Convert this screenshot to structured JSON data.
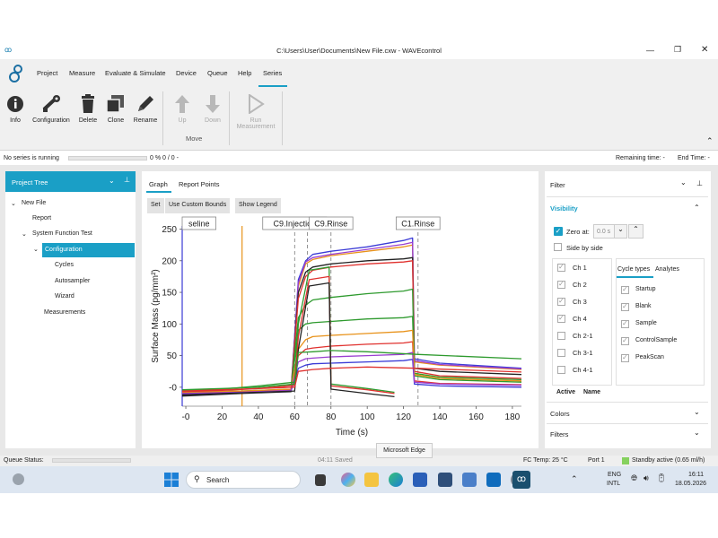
{
  "window": {
    "title": "C:\\Users\\User\\Documents\\New File.cxw - WAVEcontrol"
  },
  "menu": [
    "Project",
    "Measure",
    "Evaluate & Simulate",
    "Device",
    "Queue",
    "Help",
    "Series"
  ],
  "ribbon": {
    "info": "Info",
    "configuration": "Configuration",
    "delete": "Delete",
    "clone": "Clone",
    "rename": "Rename",
    "up": "Up",
    "down": "Down",
    "move_group": "Move",
    "run_line1": "Run",
    "run_line2": "Measurement"
  },
  "status": {
    "series": "No series is running",
    "progress": "0 %  0 / 0 -",
    "remaining": "Remaining time:  -",
    "end": "End Time:  -"
  },
  "project_tree": {
    "title": "Project Tree",
    "items": [
      "New File",
      "Report",
      "System Function Test",
      "Configuration",
      "Cycles",
      "Autosampler",
      "Wizard",
      "Measurements"
    ]
  },
  "graph": {
    "tabs": [
      "Graph",
      "Report Points"
    ],
    "buttons": [
      "Set",
      "Use Custom Bounds",
      "Show Legend"
    ],
    "markers": [
      "seline",
      "C9.Injection",
      "C9.Rinse",
      "C1.Rinse"
    ]
  },
  "chart_data": {
    "type": "line",
    "xlabel": "Time (s)",
    "ylabel": "Surface Mass (pg/mm²)",
    "xlim": [
      -2,
      185
    ],
    "ylim": [
      -30,
      255
    ],
    "xticks": [
      0,
      20,
      40,
      60,
      80,
      100,
      120,
      140,
      160,
      180
    ],
    "yticks": [
      0,
      50,
      100,
      150,
      200,
      250
    ],
    "xtick_labels": [
      "-0",
      "20",
      "40",
      "60",
      "80",
      "100",
      "120",
      "140",
      "160",
      "180"
    ],
    "ytick_labels": [
      "-0",
      "50",
      "100",
      "150",
      "200",
      "250"
    ],
    "marker_lines": [
      -2,
      31,
      60,
      67,
      80,
      128
    ],
    "series": [
      {
        "color": "#3b3bd6",
        "x": [
          -2,
          30,
          58,
          62,
          66,
          70,
          80,
          100,
          120,
          125,
          126,
          140,
          185
        ],
        "y": [
          -10,
          -8,
          -5,
          170,
          200,
          210,
          215,
          222,
          232,
          236,
          45,
          38,
          30
        ]
      },
      {
        "color": "#e8921a",
        "x": [
          -2,
          30,
          58,
          62,
          66,
          70,
          80,
          100,
          120,
          125,
          126,
          140,
          185
        ],
        "y": [
          -10,
          -8,
          -5,
          160,
          195,
          202,
          208,
          215,
          222,
          225,
          40,
          35,
          28
        ]
      },
      {
        "color": "#9a3fd0",
        "x": [
          -2,
          30,
          58,
          62,
          66,
          70,
          80,
          100,
          120,
          125,
          126,
          140,
          185
        ],
        "y": [
          -12,
          -9,
          -6,
          165,
          198,
          205,
          210,
          218,
          226,
          229,
          42,
          36,
          29
        ]
      },
      {
        "color": "#222222",
        "x": [
          -2,
          30,
          58,
          62,
          66,
          70,
          80,
          100,
          120,
          125,
          126,
          140,
          185
        ],
        "y": [
          -14,
          -10,
          -7,
          150,
          182,
          190,
          195,
          200,
          203,
          205,
          30,
          25,
          20
        ]
      },
      {
        "color": "#e0312e",
        "x": [
          -2,
          30,
          58,
          62,
          66,
          70,
          80,
          100,
          120,
          125,
          126,
          140,
          185
        ],
        "y": [
          -12,
          -9,
          -6,
          140,
          175,
          185,
          190,
          195,
          198,
          200,
          25,
          18,
          14
        ]
      },
      {
        "color": "#2e9a2e",
        "x": [
          -2,
          30,
          58,
          62,
          66,
          70,
          80,
          100,
          120,
          125,
          126,
          140,
          185
        ],
        "y": [
          -10,
          -8,
          -4,
          110,
          130,
          138,
          142,
          148,
          152,
          155,
          22,
          16,
          12
        ]
      },
      {
        "color": "#2e9a2e",
        "x": [
          -2,
          30,
          58,
          62,
          66,
          70,
          80,
          100,
          120,
          125,
          126,
          140,
          185
        ],
        "y": [
          -8,
          -6,
          -3,
          90,
          100,
          102,
          104,
          108,
          110,
          112,
          18,
          12,
          8
        ]
      },
      {
        "color": "#e0312e",
        "x": [
          -2,
          30,
          58,
          62,
          66,
          70,
          80,
          100,
          120,
          125,
          126,
          140,
          185
        ],
        "y": [
          -10,
          -7,
          -4,
          50,
          60,
          62,
          65,
          68,
          70,
          72,
          10,
          6,
          4
        ]
      },
      {
        "color": "#e8921a",
        "x": [
          -2,
          30,
          58,
          62,
          66,
          70,
          80,
          100,
          120,
          125,
          126,
          140,
          185
        ],
        "y": [
          -8,
          -6,
          -3,
          60,
          75,
          80,
          82,
          85,
          88,
          90,
          20,
          14,
          10
        ]
      },
      {
        "color": "#3b3bd6",
        "x": [
          -2,
          30,
          58,
          62,
          66,
          70,
          80,
          100,
          120,
          125,
          126,
          140,
          185
        ],
        "y": [
          -12,
          -9,
          -6,
          30,
          35,
          37,
          38,
          40,
          42,
          44,
          5,
          2,
          0
        ]
      },
      {
        "color": "#9a3fd0",
        "x": [
          -2,
          30,
          58,
          62,
          66,
          70,
          80,
          100,
          120,
          125,
          126,
          140,
          185
        ],
        "y": [
          -10,
          -8,
          -5,
          40,
          45,
          46,
          48,
          50,
          52,
          55,
          8,
          5,
          3
        ]
      },
      {
        "color": "#2e9a2e",
        "x": [
          -2,
          20,
          40,
          60,
          62,
          68,
          79,
          80,
          100,
          115
        ],
        "y": [
          -5,
          -3,
          2,
          8,
          100,
          185,
          190,
          5,
          -2,
          -8
        ]
      },
      {
        "color": "#e0312e",
        "x": [
          -2,
          20,
          40,
          60,
          62,
          68,
          79,
          80,
          100,
          115
        ],
        "y": [
          -7,
          -5,
          -2,
          3,
          80,
          170,
          175,
          2,
          -4,
          -10
        ]
      },
      {
        "color": "#222222",
        "x": [
          -2,
          20,
          40,
          60,
          62,
          68,
          79,
          80,
          100,
          115
        ],
        "y": [
          -12,
          -10,
          -8,
          -6,
          60,
          160,
          165,
          -3,
          -10,
          -15
        ]
      },
      {
        "color": "#2e9a2e",
        "x": [
          -2,
          20,
          40,
          60,
          62,
          70,
          80,
          100,
          127,
          185
        ],
        "y": [
          -4,
          -2,
          0,
          5,
          55,
          56,
          58,
          56,
          52,
          45
        ]
      },
      {
        "color": "#e0312e",
        "x": [
          -2,
          20,
          40,
          60,
          62,
          70,
          80,
          100,
          127,
          185
        ],
        "y": [
          -6,
          -4,
          -2,
          0,
          25,
          28,
          30,
          32,
          30,
          24
        ]
      }
    ]
  },
  "filter": {
    "title": "Filter",
    "visibility": "Visibility",
    "zero_at_label": "Zero at:",
    "zero_at_value": "0.0 s",
    "side_by_side": "Side by side",
    "channels": [
      "Ch 1",
      "Ch 2",
      "Ch 3",
      "Ch 4",
      "Ch 2-1",
      "Ch 3-1",
      "Ch 4-1"
    ],
    "tabs": [
      "Cycle types",
      "Analytes"
    ],
    "cycle_types": [
      "Startup",
      "Blank",
      "Sample",
      "ControlSample",
      "PeakScan"
    ],
    "columns": [
      "Active",
      "Name"
    ],
    "colors": "Colors",
    "filters": "Filters"
  },
  "queue": {
    "label": "Queue Status:",
    "saved": "04:11 Saved",
    "fc_temp": "FC Temp: 25 °C",
    "port": "Port 1",
    "standby": "Standby active (0.65 ml/h)"
  },
  "tooltip": "Microsoft Edge",
  "taskbar": {
    "search": "Search",
    "lang1": "ENG",
    "lang2": "INTL",
    "time": "16:11",
    "date": "18.05.2026"
  }
}
